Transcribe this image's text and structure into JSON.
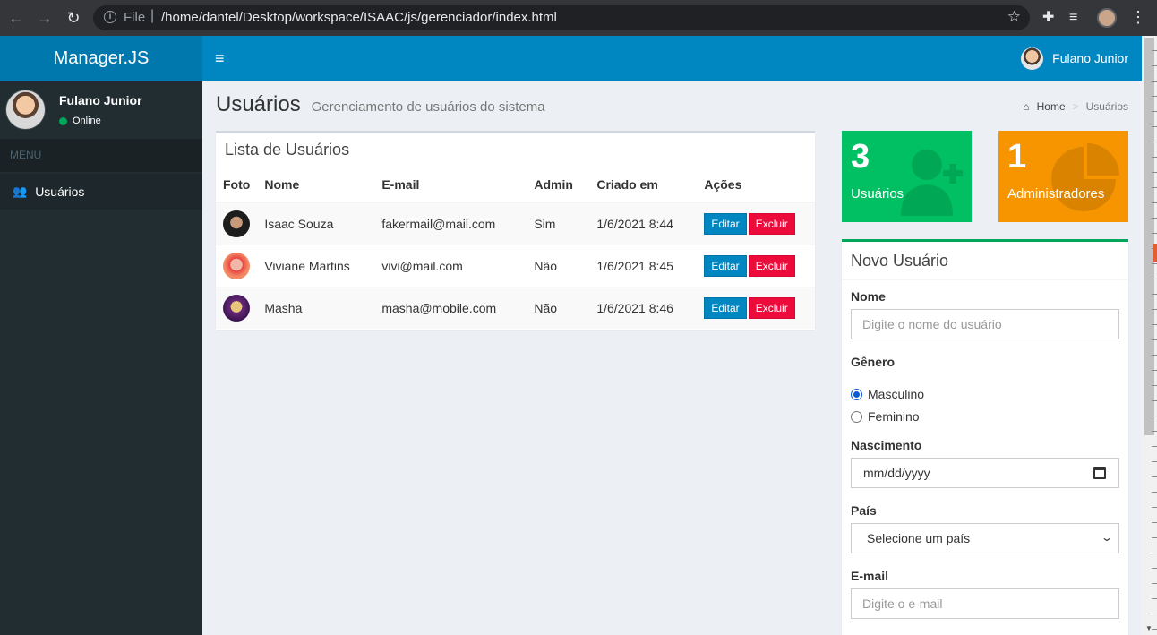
{
  "browser": {
    "scheme": "File",
    "url": "/home/dantel/Desktop/workspace/ISAAC/js/gerenciador/index.html"
  },
  "app": {
    "logo": "Manager.JS",
    "top_user": "Fulano Junior"
  },
  "sidebar": {
    "user_name": "Fulano Junior",
    "status": "Online",
    "menu_header": "MENU",
    "items": [
      {
        "label": "Usuários",
        "icon": "users-icon"
      }
    ]
  },
  "header": {
    "title": "Usuários",
    "subtitle": "Gerenciamento de usuários do sistema",
    "breadcrumb": {
      "home": "Home",
      "current": "Usuários"
    }
  },
  "user_list": {
    "title": "Lista de Usuários",
    "columns": [
      "Foto",
      "Nome",
      "E-mail",
      "Admin",
      "Criado em",
      "Ações"
    ],
    "rows": [
      {
        "name": "Isaac Souza",
        "email": "fakermail@mail.com",
        "admin": "Sim",
        "created": "1/6/2021 8:44"
      },
      {
        "name": "Viviane Martins",
        "email": "vivi@mail.com",
        "admin": "Não",
        "created": "1/6/2021 8:45"
      },
      {
        "name": "Masha",
        "email": "masha@mobile.com",
        "admin": "Não",
        "created": "1/6/2021 8:46"
      }
    ],
    "edit_label": "Editar",
    "delete_label": "Excluir"
  },
  "stats": {
    "users": {
      "value": "3",
      "label": "Usuários",
      "color": "#00c063"
    },
    "admins": {
      "value": "1",
      "label": "Administradores",
      "color": "#f79500"
    }
  },
  "form": {
    "title": "Novo Usuário",
    "name_label": "Nome",
    "name_placeholder": "Digite o nome do usuário",
    "gender_label": "Gênero",
    "gender_options": [
      "Masculino",
      "Feminino"
    ],
    "birth_label": "Nascimento",
    "birth_placeholder": "mm/dd/yyyy",
    "country_label": "País",
    "country_selected": "Selecione um país",
    "email_label": "E-mail",
    "email_placeholder": "Digite o e-mail"
  }
}
